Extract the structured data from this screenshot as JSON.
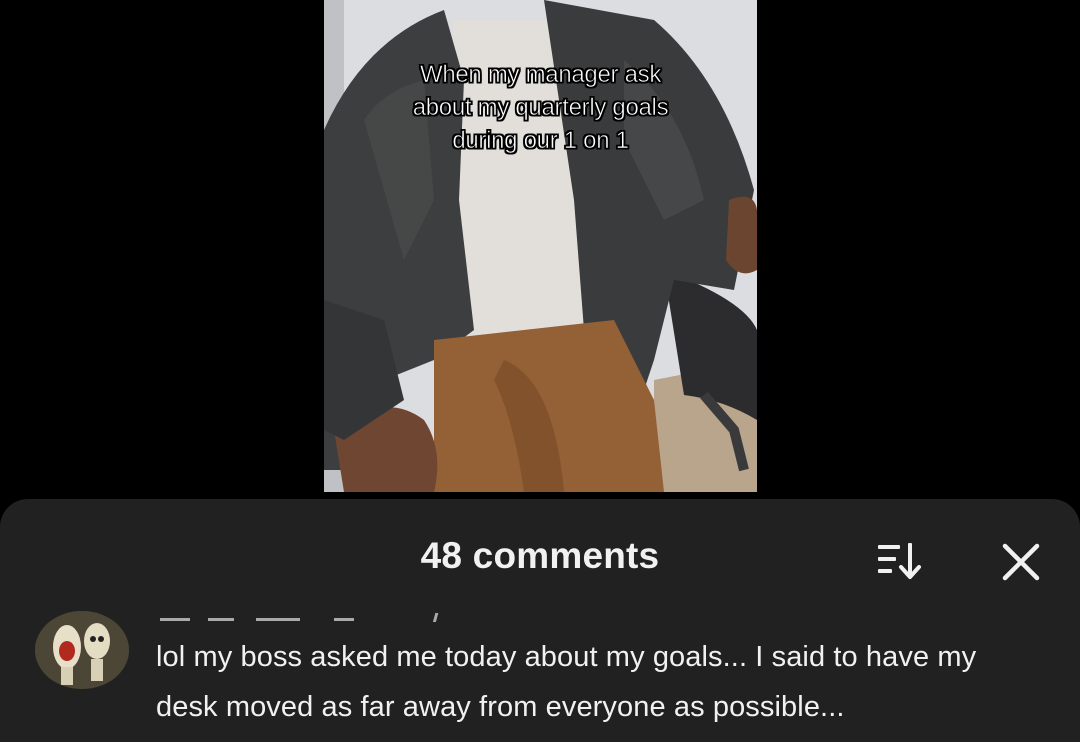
{
  "video": {
    "caption_lines": [
      "When my manager ask",
      "about my quarterly goals",
      "during our 1 on 1"
    ]
  },
  "comments_sheet": {
    "title": "48 comments",
    "sort_icon": "sort-icon",
    "close_icon": "close-icon",
    "colors": {
      "sheet_background": "#212121",
      "text": "#f1f1f1"
    },
    "comments": [
      {
        "avatar_icon": "avatar",
        "text": "lol my boss asked me today about my goals... I said to have my desk moved as far away from everyone as possible..."
      }
    ]
  }
}
